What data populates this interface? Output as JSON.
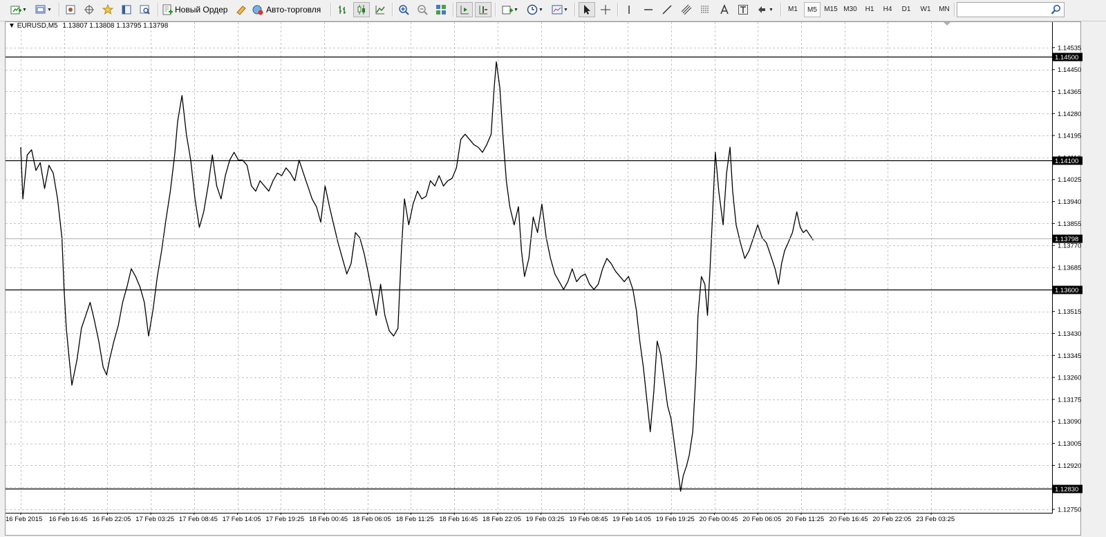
{
  "toolbar": {
    "new_order_label": "Новый Ордер",
    "autotrading_label": "Авто-торговля",
    "timeframes": [
      "M1",
      "M5",
      "M15",
      "M30",
      "H1",
      "H4",
      "D1",
      "W1",
      "MN"
    ],
    "active_timeframe": "M5",
    "search_value": ""
  },
  "chart": {
    "symbol": "EURUSD,M5",
    "ohlc": "1.13807 1.13808 1.13795 1.13798",
    "colors": {
      "background": "#ffffff",
      "grid": "#c0c0c0",
      "price_line": "#000000",
      "level_label_bg": "#000000",
      "level_label_text": "#ffffff"
    }
  },
  "chart_data": {
    "type": "line",
    "symbol": "EURUSD",
    "timeframe": "M5",
    "ylim": [
      1.1275,
      1.1458
    ],
    "y_ticks": [
      "1.14535",
      "1.14450",
      "1.14365",
      "1.14280",
      "1.14195",
      "1.14110",
      "1.14025",
      "1.13940",
      "1.13855",
      "1.13770",
      "1.13685",
      "1.13600",
      "1.13515",
      "1.13430",
      "1.13345",
      "1.13260",
      "1.13175",
      "1.13090",
      "1.13005",
      "1.12920",
      "1.12835",
      "1.12750"
    ],
    "x_ticks": [
      "16 Feb 2015",
      "16 Feb 16:45",
      "16 Feb 22:05",
      "17 Feb 03:25",
      "17 Feb 08:45",
      "17 Feb 14:05",
      "17 Feb 19:25",
      "18 Feb 00:45",
      "18 Feb 06:05",
      "18 Feb 11:25",
      "18 Feb 16:45",
      "18 Feb 22:05",
      "19 Feb 03:25",
      "19 Feb 08:45",
      "19 Feb 14:05",
      "19 Feb 19:25",
      "20 Feb 00:45",
      "20 Feb 06:05",
      "20 Feb 11:25",
      "20 Feb 16:45",
      "20 Feb 22:05",
      "23 Feb 03:25"
    ],
    "levels": [
      "1.14500",
      "1.14100",
      "1.13600",
      "1.12830"
    ],
    "current_price": "1.13798",
    "grid": true,
    "x_index_range": [
      0,
      21.9
    ],
    "price_series": [
      [
        0,
        1.1415
      ],
      [
        0.05,
        1.1395
      ],
      [
        0.15,
        1.1412
      ],
      [
        0.25,
        1.1414
      ],
      [
        0.35,
        1.1406
      ],
      [
        0.45,
        1.1409
      ],
      [
        0.55,
        1.1399
      ],
      [
        0.65,
        1.1408
      ],
      [
        0.75,
        1.1405
      ],
      [
        0.85,
        1.1395
      ],
      [
        0.95,
        1.138
      ],
      [
        1.0,
        1.136
      ],
      [
        1.05,
        1.1345
      ],
      [
        1.12,
        1.1333
      ],
      [
        1.18,
        1.1323
      ],
      [
        1.3,
        1.1333
      ],
      [
        1.4,
        1.1345
      ],
      [
        1.5,
        1.135
      ],
      [
        1.6,
        1.1355
      ],
      [
        1.7,
        1.1348
      ],
      [
        1.8,
        1.134
      ],
      [
        1.9,
        1.133
      ],
      [
        1.98,
        1.1327
      ],
      [
        2.05,
        1.1333
      ],
      [
        2.15,
        1.134
      ],
      [
        2.25,
        1.1346
      ],
      [
        2.35,
        1.1355
      ],
      [
        2.45,
        1.1361
      ],
      [
        2.55,
        1.1368
      ],
      [
        2.65,
        1.1365
      ],
      [
        2.75,
        1.1361
      ],
      [
        2.85,
        1.1355
      ],
      [
        2.95,
        1.1342
      ],
      [
        3.05,
        1.1352
      ],
      [
        3.15,
        1.1365
      ],
      [
        3.25,
        1.1375
      ],
      [
        3.35,
        1.1387
      ],
      [
        3.45,
        1.1398
      ],
      [
        3.55,
        1.1412
      ],
      [
        3.62,
        1.1425
      ],
      [
        3.72,
        1.1435
      ],
      [
        3.82,
        1.142
      ],
      [
        3.92,
        1.141
      ],
      [
        4.02,
        1.1395
      ],
      [
        4.12,
        1.1384
      ],
      [
        4.22,
        1.139
      ],
      [
        4.32,
        1.14
      ],
      [
        4.42,
        1.1412
      ],
      [
        4.52,
        1.14
      ],
      [
        4.62,
        1.1395
      ],
      [
        4.72,
        1.1404
      ],
      [
        4.82,
        1.141
      ],
      [
        4.92,
        1.1413
      ],
      [
        5.02,
        1.141
      ],
      [
        5.12,
        1.141
      ],
      [
        5.22,
        1.1408
      ],
      [
        5.32,
        1.14
      ],
      [
        5.42,
        1.1398
      ],
      [
        5.52,
        1.1402
      ],
      [
        5.62,
        1.14
      ],
      [
        5.72,
        1.1398
      ],
      [
        5.82,
        1.1402
      ],
      [
        5.92,
        1.1405
      ],
      [
        6.02,
        1.1404
      ],
      [
        6.12,
        1.1407
      ],
      [
        6.22,
        1.1405
      ],
      [
        6.32,
        1.1402
      ],
      [
        6.42,
        1.141
      ],
      [
        6.52,
        1.1405
      ],
      [
        6.62,
        1.14
      ],
      [
        6.72,
        1.1395
      ],
      [
        6.82,
        1.1392
      ],
      [
        6.92,
        1.1386
      ],
      [
        7.02,
        1.14
      ],
      [
        7.12,
        1.1392
      ],
      [
        7.22,
        1.1385
      ],
      [
        7.32,
        1.1378
      ],
      [
        7.42,
        1.1372
      ],
      [
        7.52,
        1.1366
      ],
      [
        7.62,
        1.137
      ],
      [
        7.72,
        1.1382
      ],
      [
        7.82,
        1.138
      ],
      [
        7.92,
        1.1374
      ],
      [
        8.02,
        1.1366
      ],
      [
        8.12,
        1.1357
      ],
      [
        8.2,
        1.135
      ],
      [
        8.3,
        1.1362
      ],
      [
        8.4,
        1.135
      ],
      [
        8.5,
        1.1344
      ],
      [
        8.6,
        1.1342
      ],
      [
        8.7,
        1.1345
      ],
      [
        8.78,
        1.1375
      ],
      [
        8.85,
        1.1395
      ],
      [
        8.95,
        1.1385
      ],
      [
        9.05,
        1.1393
      ],
      [
        9.15,
        1.1398
      ],
      [
        9.25,
        1.1395
      ],
      [
        9.35,
        1.1396
      ],
      [
        9.45,
        1.1402
      ],
      [
        9.55,
        1.14
      ],
      [
        9.65,
        1.1404
      ],
      [
        9.75,
        1.14
      ],
      [
        9.85,
        1.1402
      ],
      [
        9.95,
        1.1403
      ],
      [
        10.05,
        1.1407
      ],
      [
        10.15,
        1.1418
      ],
      [
        10.25,
        1.142
      ],
      [
        10.35,
        1.1418
      ],
      [
        10.45,
        1.1416
      ],
      [
        10.55,
        1.1415
      ],
      [
        10.65,
        1.1413
      ],
      [
        10.75,
        1.1416
      ],
      [
        10.85,
        1.142
      ],
      [
        10.92,
        1.1438
      ],
      [
        10.97,
        1.1448
      ],
      [
        11.05,
        1.1438
      ],
      [
        11.12,
        1.142
      ],
      [
        11.2,
        1.1402
      ],
      [
        11.28,
        1.1392
      ],
      [
        11.38,
        1.1385
      ],
      [
        11.48,
        1.1392
      ],
      [
        11.55,
        1.1375
      ],
      [
        11.62,
        1.1365
      ],
      [
        11.72,
        1.1372
      ],
      [
        11.82,
        1.1388
      ],
      [
        11.92,
        1.1382
      ],
      [
        12.02,
        1.1393
      ],
      [
        12.12,
        1.138
      ],
      [
        12.22,
        1.1372
      ],
      [
        12.32,
        1.1366
      ],
      [
        12.42,
        1.1363
      ],
      [
        12.52,
        1.136
      ],
      [
        12.62,
        1.1363
      ],
      [
        12.72,
        1.1368
      ],
      [
        12.82,
        1.1363
      ],
      [
        12.92,
        1.1365
      ],
      [
        13.02,
        1.1366
      ],
      [
        13.12,
        1.1362
      ],
      [
        13.22,
        1.136
      ],
      [
        13.32,
        1.1362
      ],
      [
        13.42,
        1.1368
      ],
      [
        13.52,
        1.1372
      ],
      [
        13.62,
        1.137
      ],
      [
        13.72,
        1.1367
      ],
      [
        13.82,
        1.1365
      ],
      [
        13.92,
        1.1363
      ],
      [
        14.02,
        1.1365
      ],
      [
        14.12,
        1.136
      ],
      [
        14.2,
        1.1352
      ],
      [
        14.28,
        1.134
      ],
      [
        14.36,
        1.133
      ],
      [
        14.45,
        1.1316
      ],
      [
        14.52,
        1.1305
      ],
      [
        14.6,
        1.132
      ],
      [
        14.68,
        1.134
      ],
      [
        14.76,
        1.1335
      ],
      [
        14.84,
        1.1325
      ],
      [
        14.92,
        1.1315
      ],
      [
        15.0,
        1.131
      ],
      [
        15.08,
        1.13
      ],
      [
        15.16,
        1.129
      ],
      [
        15.22,
        1.1282
      ],
      [
        15.28,
        1.1288
      ],
      [
        15.36,
        1.1292
      ],
      [
        15.42,
        1.1296
      ],
      [
        15.5,
        1.1305
      ],
      [
        15.58,
        1.133
      ],
      [
        15.62,
        1.135
      ],
      [
        15.7,
        1.1365
      ],
      [
        15.78,
        1.1362
      ],
      [
        15.84,
        1.135
      ],
      [
        15.9,
        1.1368
      ],
      [
        15.96,
        1.139
      ],
      [
        16.02,
        1.1413
      ],
      [
        16.1,
        1.1398
      ],
      [
        16.2,
        1.1385
      ],
      [
        16.28,
        1.1405
      ],
      [
        16.36,
        1.1415
      ],
      [
        16.42,
        1.1398
      ],
      [
        16.5,
        1.1385
      ],
      [
        16.6,
        1.1378
      ],
      [
        16.7,
        1.1372
      ],
      [
        16.8,
        1.1375
      ],
      [
        16.9,
        1.138
      ],
      [
        17.0,
        1.1385
      ],
      [
        17.1,
        1.138
      ],
      [
        17.2,
        1.1378
      ],
      [
        17.3,
        1.1373
      ],
      [
        17.4,
        1.1368
      ],
      [
        17.48,
        1.1362
      ],
      [
        17.55,
        1.137
      ],
      [
        17.62,
        1.1375
      ],
      [
        17.7,
        1.1378
      ],
      [
        17.8,
        1.1382
      ],
      [
        17.9,
        1.139
      ],
      [
        17.98,
        1.1384
      ],
      [
        18.05,
        1.1382
      ],
      [
        18.12,
        1.1383
      ],
      [
        18.2,
        1.1381
      ],
      [
        18.28,
        1.1379
      ]
    ]
  }
}
